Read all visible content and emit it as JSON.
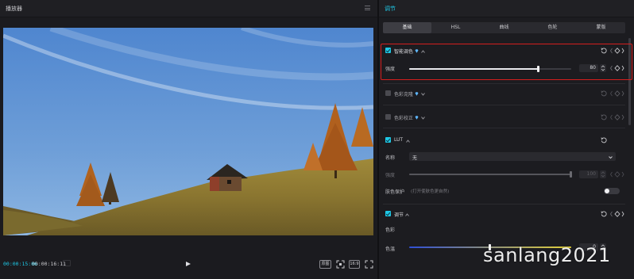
{
  "player": {
    "title": "播放器",
    "time_current": "00:00:15:06",
    "time_total": "00:00:16:11",
    "buttons": {
      "original_label": "原图",
      "ratio_label": "16:9"
    }
  },
  "adjust": {
    "title": "调节",
    "tabs": [
      {
        "label": "基础",
        "active": true
      },
      {
        "label": "HSL",
        "active": false
      },
      {
        "label": "曲线",
        "active": false
      },
      {
        "label": "色轮",
        "active": false
      },
      {
        "label": "蒙版",
        "active": false
      }
    ],
    "sections": {
      "smart_color": {
        "label": "智能调色",
        "checked": true,
        "intensity_label": "强度",
        "intensity_value": "80",
        "intensity_fraction": 0.8
      },
      "color_match": {
        "label": "色彩克隆",
        "checked": false
      },
      "color_correct": {
        "label": "色彩校正",
        "checked": false
      },
      "lut": {
        "label": "LUT",
        "checked": true,
        "name_label": "名称",
        "name_value": "无",
        "intensity_label": "强度",
        "intensity_value": "100",
        "intensity_fraction": 1.0,
        "skin_label": "肤色保护",
        "skin_note": "(打开使肤色更自然)",
        "skin_enabled": false
      },
      "adjust": {
        "label": "调节",
        "checked": true,
        "color_label": "色彩",
        "temp_label": "色温",
        "temp_value": "0",
        "temp_fraction": 0.5
      }
    }
  },
  "watermark": "sanlang2021",
  "colors": {
    "accent": "#1ec8e6",
    "highlight": "#d41e1e"
  }
}
